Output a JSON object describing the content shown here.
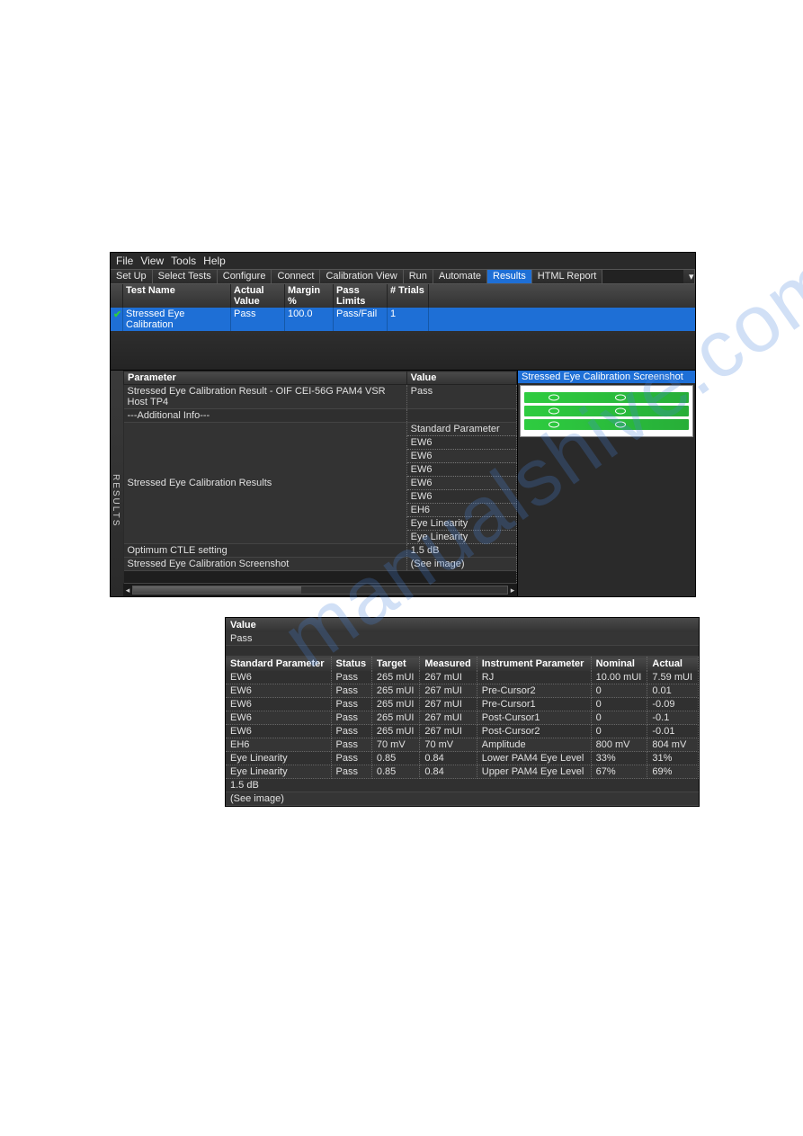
{
  "watermark": "manualshive.com",
  "menubar": [
    "File",
    "View",
    "Tools",
    "Help"
  ],
  "tabs": [
    "Set Up",
    "Select Tests",
    "Configure",
    "Connect",
    "Calibration View",
    "Run",
    "Automate",
    "Results",
    "HTML Report"
  ],
  "active_tab": "Results",
  "sidebar_label": "RESULTS",
  "result_header": {
    "test_name": "Test Name",
    "actual_value": "Actual Value",
    "margin": "Margin %",
    "pass_limits": "Pass Limits",
    "trials": "# Trials"
  },
  "result_row": {
    "test_name": "Stressed Eye Calibration",
    "actual_value": "Pass",
    "margin": "100.0",
    "pass_limits": "Pass/Fail",
    "trials": "1"
  },
  "param_header": {
    "parameter": "Parameter",
    "value": "Value"
  },
  "param_rows": [
    {
      "parameter": "Stressed Eye Calibration Result - OIF CEI-56G PAM4 VSR Host TP4",
      "value": "Pass"
    },
    {
      "parameter": "---Additional Info---",
      "value": ""
    }
  ],
  "cal_results_label": "Stressed Eye Calibration Results",
  "inner_value_rows": [
    "Standard Parameter",
    "EW6",
    "EW6",
    "EW6",
    "EW6",
    "EW6",
    "EH6",
    "Eye Linearity",
    "Eye Linearity"
  ],
  "optimum_row": {
    "parameter": "Optimum CTLE setting",
    "value": "1.5 dB"
  },
  "screenshot_row": {
    "parameter": "Stressed Eye Calibration Screenshot",
    "value": "(See image)"
  },
  "right_panel_title": "Stressed Eye Calibration Screenshot",
  "zoom": {
    "value_header": "Value",
    "pass_row": "Pass",
    "cols": [
      "Standard Parameter",
      "Status",
      "Target",
      "Measured",
      "Instrument Parameter",
      "Nominal",
      "Actual"
    ],
    "rows": [
      [
        "EW6",
        "Pass",
        "265 mUI",
        "267 mUI",
        "RJ",
        "10.00 mUI",
        "7.59 mUI"
      ],
      [
        "EW6",
        "Pass",
        "265 mUI",
        "267 mUI",
        "Pre-Cursor2",
        "0",
        "0.01"
      ],
      [
        "EW6",
        "Pass",
        "265 mUI",
        "267 mUI",
        "Pre-Cursor1",
        "0",
        "-0.09"
      ],
      [
        "EW6",
        "Pass",
        "265 mUI",
        "267 mUI",
        "Post-Cursor1",
        "0",
        "-0.1"
      ],
      [
        "EW6",
        "Pass",
        "265 mUI",
        "267 mUI",
        "Post-Cursor2",
        "0",
        "-0.01"
      ],
      [
        "EH6",
        "Pass",
        "70 mV",
        "70 mV",
        "Amplitude",
        "800 mV",
        "804 mV"
      ],
      [
        "Eye Linearity",
        "Pass",
        "0.85",
        "0.84",
        "Lower PAM4 Eye Level",
        "33%",
        "31%"
      ],
      [
        "Eye Linearity",
        "Pass",
        "0.85",
        "0.84",
        "Upper PAM4 Eye Level",
        "67%",
        "69%"
      ]
    ],
    "optimum": "1.5 dB",
    "see_image": "(See image)"
  }
}
